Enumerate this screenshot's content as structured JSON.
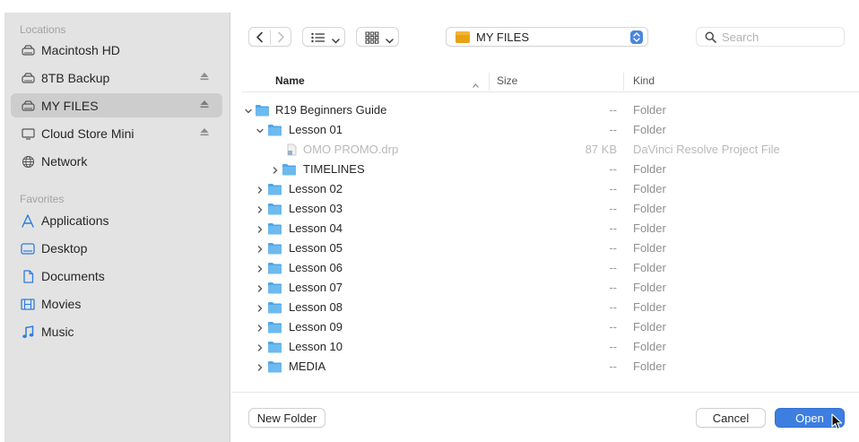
{
  "sidebar": {
    "locations_title": "Locations",
    "locations": [
      {
        "label": "Macintosh HD",
        "icon": "drive-icon",
        "eject": false,
        "selected": false
      },
      {
        "label": "8TB Backup",
        "icon": "drive-icon",
        "eject": true,
        "selected": false
      },
      {
        "label": "MY FILES",
        "icon": "drive-icon",
        "eject": true,
        "selected": true
      },
      {
        "label": "Cloud Store Mini",
        "icon": "display-icon",
        "eject": true,
        "selected": false
      },
      {
        "label": "Network",
        "icon": "globe-icon",
        "eject": false,
        "selected": false
      }
    ],
    "favorites_title": "Favorites",
    "favorites": [
      {
        "label": "Applications",
        "icon": "applications-icon"
      },
      {
        "label": "Desktop",
        "icon": "desktop-icon"
      },
      {
        "label": "Documents",
        "icon": "document-icon"
      },
      {
        "label": "Movies",
        "icon": "film-icon"
      },
      {
        "label": "Music",
        "icon": "music-note-icon"
      }
    ]
  },
  "toolbar": {
    "location": "MY FILES",
    "search_placeholder": "Search"
  },
  "columns": {
    "name": "Name",
    "size": "Size",
    "kind": "Kind"
  },
  "rows": [
    {
      "name": "R19 Beginners Guide",
      "size": "--",
      "kind": "Folder",
      "level": 0,
      "expanded": true,
      "type": "folder"
    },
    {
      "name": "Lesson 01",
      "size": "--",
      "kind": "Folder",
      "level": 1,
      "expanded": true,
      "type": "folder"
    },
    {
      "name": "OMO PROMO.drp",
      "size": "87 KB",
      "kind": "DaVinci Resolve Project File",
      "level": 2,
      "expanded": false,
      "type": "file",
      "dimmed": true
    },
    {
      "name": "TIMELINES",
      "size": "--",
      "kind": "Folder",
      "level": 2,
      "expanded": false,
      "type": "folder"
    },
    {
      "name": "Lesson 02",
      "size": "--",
      "kind": "Folder",
      "level": 1,
      "expanded": false,
      "type": "folder"
    },
    {
      "name": "Lesson 03",
      "size": "--",
      "kind": "Folder",
      "level": 1,
      "expanded": false,
      "type": "folder"
    },
    {
      "name": "Lesson 04",
      "size": "--",
      "kind": "Folder",
      "level": 1,
      "expanded": false,
      "type": "folder"
    },
    {
      "name": "Lesson 05",
      "size": "--",
      "kind": "Folder",
      "level": 1,
      "expanded": false,
      "type": "folder"
    },
    {
      "name": "Lesson 06",
      "size": "--",
      "kind": "Folder",
      "level": 1,
      "expanded": false,
      "type": "folder"
    },
    {
      "name": "Lesson 07",
      "size": "--",
      "kind": "Folder",
      "level": 1,
      "expanded": false,
      "type": "folder"
    },
    {
      "name": "Lesson 08",
      "size": "--",
      "kind": "Folder",
      "level": 1,
      "expanded": false,
      "type": "folder"
    },
    {
      "name": "Lesson 09",
      "size": "--",
      "kind": "Folder",
      "level": 1,
      "expanded": false,
      "type": "folder"
    },
    {
      "name": "Lesson 10",
      "size": "--",
      "kind": "Folder",
      "level": 1,
      "expanded": false,
      "type": "folder"
    },
    {
      "name": "MEDIA",
      "size": "--",
      "kind": "Folder",
      "level": 1,
      "expanded": false,
      "type": "folder"
    }
  ],
  "footer": {
    "new_folder": "New Folder",
    "cancel": "Cancel",
    "open": "Open"
  },
  "colors": {
    "accent": "#3d7ee0",
    "folder": "#5ab0ea",
    "sidebar_bg": "#e3e3e3"
  }
}
